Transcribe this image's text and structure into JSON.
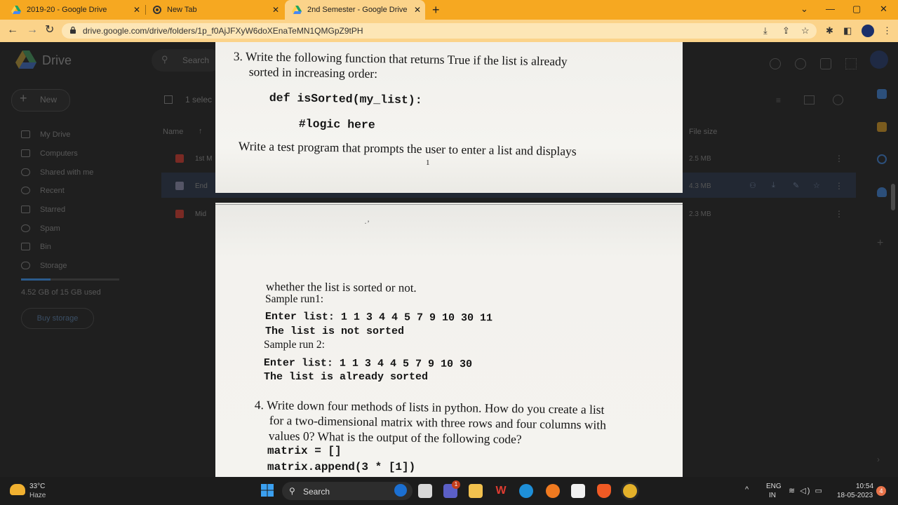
{
  "browser": {
    "tabs": [
      {
        "label": "2019-20 - Google Drive",
        "icon": "google-drive-icon",
        "active": false
      },
      {
        "label": "New Tab",
        "icon": "chrome-icon",
        "active": false
      },
      {
        "label": "2nd Semester - Google Drive",
        "icon": "google-drive-icon",
        "active": true
      }
    ],
    "close_glyph": "✕",
    "new_tab_glyph": "+",
    "url": "drive.google.com/drive/folders/1p_f0AjJFXyW6doXEnaTeMN1QMGpZ9tPH",
    "window_controls": {
      "dropdown": "⌄",
      "minimize": "—",
      "maximize": "▢",
      "close": "✕"
    },
    "nav": {
      "back": "←",
      "forward": "→",
      "reload": "↻"
    },
    "toolbar_glyphs": {
      "install": "⤓",
      "share": "⇪",
      "star": "☆",
      "extensions": "✱",
      "sidebar": "◧",
      "menu": "⋮"
    }
  },
  "drive": {
    "app_name": "Drive",
    "search_placeholder": "Search",
    "new_label": "New",
    "selection_text": "1 selec",
    "sidebar_items": [
      {
        "label": "My Drive",
        "icon": "my-drive-icon"
      },
      {
        "label": "Computers",
        "icon": "computer-icon"
      },
      {
        "label": "Shared with me",
        "icon": "people-icon"
      },
      {
        "label": "Recent",
        "icon": "clock-icon"
      },
      {
        "label": "Starred",
        "icon": "star-icon"
      },
      {
        "label": "Spam",
        "icon": "spam-icon"
      },
      {
        "label": "Bin",
        "icon": "trash-icon"
      },
      {
        "label": "Storage",
        "icon": "cloud-icon"
      }
    ],
    "storage_text": "4.52 GB of 15 GB used",
    "storage_fraction": 0.3,
    "buy_storage": "Buy storage",
    "columns": {
      "name": "Name",
      "size": "File size",
      "sort_glyph": "↑"
    },
    "files": [
      {
        "name": "1st M",
        "size": "2.5 MB",
        "selected": false
      },
      {
        "name": "End",
        "size": "4.3 MB",
        "selected": true
      },
      {
        "name": "Mid",
        "size": "2.3 MB",
        "selected": false
      }
    ],
    "more_glyph": "⋮"
  },
  "document": {
    "page1": {
      "q3_line1": "3. Write the following function that returns True if the list is already",
      "q3_line2": "sorted in increasing order:",
      "code_def": "def isSorted(my_list):",
      "code_comment": "#logic here",
      "q3_line3": "Write a test program that prompts the user to enter a list and displays",
      "page_number": "1"
    },
    "page2": {
      "stray_mark": "·’",
      "cont_line": "whether the list is sorted or not.",
      "sample1_label": "Sample run1:",
      "sample1_input": "Enter list:  1 1 3 4 4 5 7 9 10 30 11",
      "sample1_output": "The list is not sorted",
      "sample2_label": "Sample run 2:",
      "sample2_input": "Enter list:  1 1 3 4 4 5 7 9 10 30",
      "sample2_output": "The list is already sorted",
      "q4_line1": "4. Write down four methods of lists in python. How do you create a list",
      "q4_line2": "for a two-dimensional matrix with three rows and four columns with",
      "q4_line3": "values 0? What is the output of the following code?",
      "code1": "matrix = []",
      "code2": "matrix.append(3 * [1])"
    }
  },
  "taskbar": {
    "temperature": "33°C",
    "weather": "Haze",
    "search_label": "Search",
    "search_glyph": "⚲",
    "tray_caret": "^",
    "lang_line1": "ENG",
    "lang_line2": "IN",
    "tray_glyphs": "≋ ◁) ▭",
    "time": "10:54",
    "date": "18-05-2023",
    "notifications": "4",
    "teams_badge": "1"
  }
}
